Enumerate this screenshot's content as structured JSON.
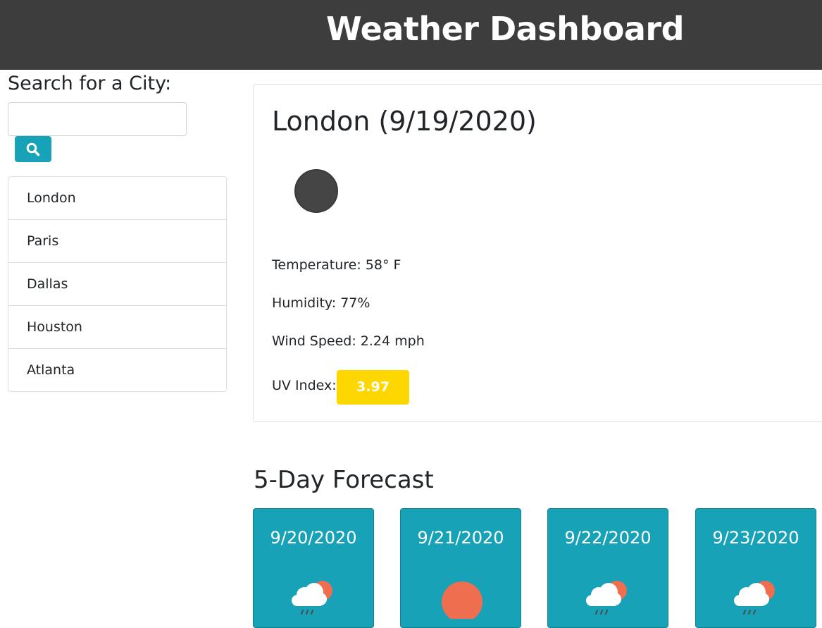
{
  "header": {
    "title": "Weather Dashboard"
  },
  "search": {
    "label": "Search for a City:",
    "input_value": "",
    "placeholder": "",
    "button_icon": "search-icon"
  },
  "cities": [
    "London",
    "Paris",
    "Dallas",
    "Houston",
    "Atlanta"
  ],
  "current": {
    "title": "London (9/19/2020)",
    "icon": "weather-icon",
    "temperature": "Temperature: 58° F",
    "humidity": "Humidity: 77%",
    "wind": "Wind Speed: 2.24 mph",
    "uv_label": "UV Index:",
    "uv_value": "3.97",
    "uv_color": "#ffd700"
  },
  "forecast": {
    "title": "5-Day Forecast",
    "days": [
      {
        "date": "9/20/2020",
        "icon": "rain-sun-cloud-icon"
      },
      {
        "date": "9/21/2020",
        "icon": "sun-icon"
      },
      {
        "date": "9/22/2020",
        "icon": "rain-sun-cloud-icon"
      },
      {
        "date": "9/23/2020",
        "icon": "rain-sun-cloud-icon"
      }
    ]
  },
  "colors": {
    "header_bg": "#3d3d3d",
    "accent": "#17a2b8",
    "uv_moderate": "#ffd700",
    "sun": "#ee6e4f"
  }
}
